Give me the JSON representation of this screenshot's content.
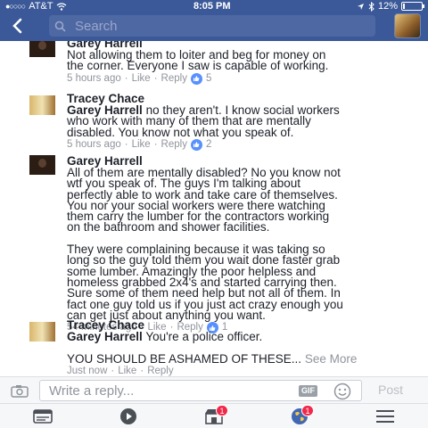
{
  "status": {
    "carrier": "AT&T",
    "time": "8:05 PM",
    "battery": "12%",
    "battery_level": 0.12
  },
  "header": {
    "search_placeholder": "Search"
  },
  "comments": [
    {
      "author": "Garey Harrell",
      "text": "Not allowing them to loiter and beg for money on\nthe corner. Everyone I saw is capable of working.",
      "time": "5 hours ago",
      "like": "Like",
      "reply": "Reply",
      "likes": "5"
    },
    {
      "author": "Tracey Chace",
      "mention": "Garey Harrell",
      "text": " no they aren't. I know social workers\nwho work with many of them that are mentally\ndisabled. You know not what you speak of.",
      "time": "5 hours ago",
      "like": "Like",
      "reply": "Reply",
      "likes": "2"
    },
    {
      "author": "Garey Harrell",
      "text": "All of them are mentally disabled? No you know not\nwtf you speak of. The guys I'm talking about\nperfectly able to work and take care of themselves.\nYou nor your social workers were there watching\nthem carry the lumber for the contractors working\non the bathroom and shower facilities.\n\nThey were complaining because it was taking so\nlong so the guy told them you wait done faster grab\nsome lumber. Amazingly the poor helpless and\nhomeless grabbed 2x4's and started carrying then.\nSure some of them need help but not all of them. In\nfact one guy told us if you just act crazy enough you\ncan get just about anything you want.",
      "time": "54 minutes ago",
      "like": "Like",
      "reply": "Reply",
      "likes": "1"
    },
    {
      "author": "Tracey Chace",
      "mention": "Garey Harrell",
      "text": " You're a police officer.\n\nYOU SHOULD BE ASHAMED OF THESE...",
      "see_more": " See More",
      "time": "Just now",
      "like": "Like",
      "reply": "Reply"
    }
  ],
  "reply_bar": {
    "placeholder": "Write a reply...",
    "gif_label": "GIF",
    "post_label": "Post"
  },
  "tabbar": {
    "friend_requests_badge": "1",
    "notifications_badge": "1"
  }
}
